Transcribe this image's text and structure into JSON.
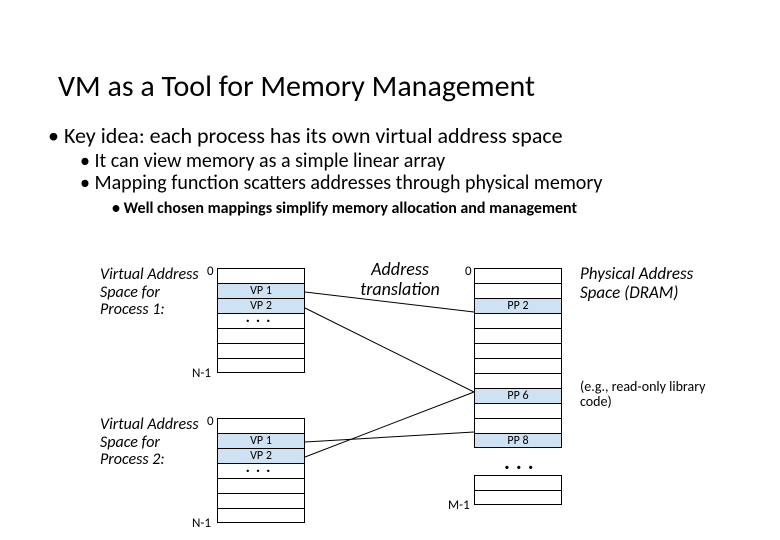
{
  "title": "VM as a Tool for Memory Management",
  "bullets": {
    "b1": "Key idea: each process has its own virtual address space",
    "b2a": "It can view memory as a simple linear array",
    "b2b": "Mapping function scatters addresses through physical memory",
    "b3": "Well chosen mappings simplify memory allocation and management"
  },
  "labels": {
    "vas1": "Virtual Address Space for Process 1:",
    "vas2": "Virtual Address Space for Process 2:",
    "pas": "Physical Address Space (DRAM)",
    "ro": "(e.g., read-only library code)",
    "addr_trans": "Address translation"
  },
  "cells": {
    "vp1": "VP 1",
    "vp2": "VP 2",
    "pp2": "PP 2",
    "pp6": "PP 6",
    "pp8": "PP 8",
    "ell": "..."
  },
  "indices": {
    "zero": "0",
    "n1": "N-1",
    "m1": "M-1"
  },
  "bullet": "•"
}
